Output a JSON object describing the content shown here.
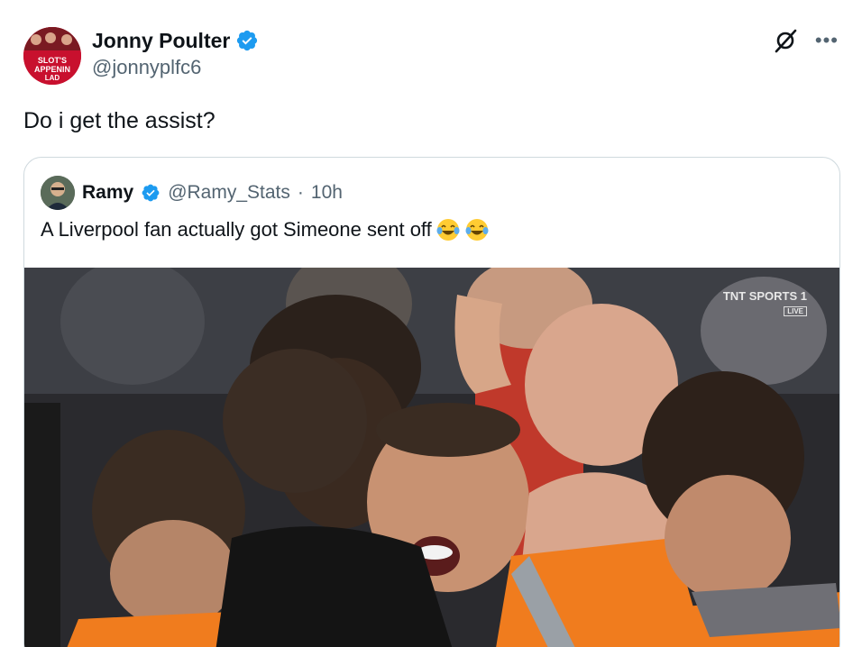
{
  "author": {
    "display_name": "Jonny Poulter",
    "handle": "@jonnyplfc6",
    "avatar_text": "SLOT'S APPENIN LAD"
  },
  "tweet": {
    "text": "Do i get the assist?"
  },
  "quote": {
    "display_name": "Ramy",
    "handle": "@Ramy_Stats",
    "separator": "·",
    "time": "10h",
    "text": "A Liverpool fan actually got Simeone sent off",
    "emojis": [
      "face-with-tears-of-joy",
      "face-with-tears-of-joy"
    ]
  },
  "media": {
    "broadcaster": "TNT SPORTS 1",
    "live_badge": "LIVE"
  },
  "colors": {
    "verified": "#1d9bf0",
    "text_primary": "#0f1419",
    "text_secondary": "#536471",
    "border": "#cfd9de"
  },
  "icons": [
    "verified-badge-icon",
    "grok-icon",
    "more-options-icon"
  ]
}
